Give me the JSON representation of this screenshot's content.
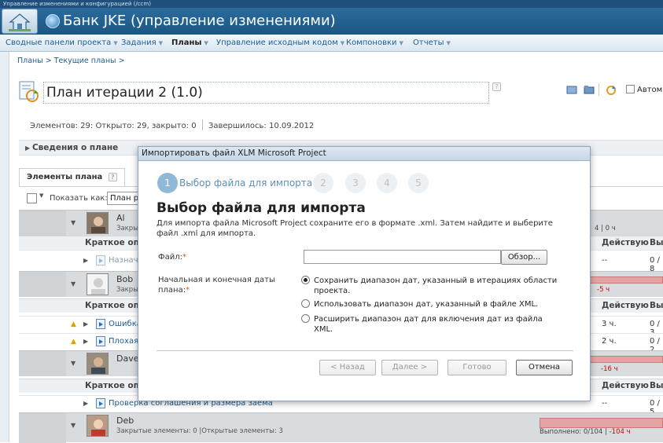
{
  "app": {
    "top_strip": "Управление изменениями и конфигурацией (/ccm)",
    "project_title": "Банк JKE (управление изменениями)"
  },
  "nav": [
    {
      "label": "Сводные панели проекта",
      "active": false
    },
    {
      "label": "Задания",
      "active": false
    },
    {
      "label": "Планы",
      "active": true
    },
    {
      "label": "Управление исходным кодом",
      "active": false
    },
    {
      "label": "Компоновки",
      "active": false
    },
    {
      "label": "Отчеты",
      "active": false
    }
  ],
  "breadcrumb": "Планы > Текущие планы >",
  "plan": {
    "title": "План итерации 2 (1.0)",
    "auto_label": "Автом",
    "stats": {
      "elements": "Элементов: 29:",
      "open_closed": "Открыто: 29, закрыто: 0",
      "finished": "Завершилось:  10.09.2012"
    },
    "info_label": "Сведения о плане",
    "tab_label": "Элементы плана",
    "show_as_label": "Показать как:",
    "show_as_value": "План р"
  },
  "table": {
    "col_summary": "Краткое опи",
    "col_action": "Действую",
    "col_next": "Вы"
  },
  "owners": [
    {
      "name": "Al",
      "sub": "Закры",
      "bar_fill_pct": 0,
      "bar_text": "4 | 0 ч",
      "bar_neg": "",
      "items": [
        {
          "warn": false,
          "title": "Назнач",
          "title_style": "dim",
          "hours": "--",
          "progress": "0 / 8"
        }
      ]
    },
    {
      "name": "Bob",
      "sub": "Закры",
      "bar_fill_pct": 0,
      "bar_text": "",
      "bar_neg": "-5 ч",
      "items": [
        {
          "warn": true,
          "title": "Ошибка",
          "hours": "3 ч.",
          "progress": "0 / 3"
        },
        {
          "warn": true,
          "title": "Плохая",
          "hours": "2 ч.",
          "progress": "0 / 2"
        }
      ]
    },
    {
      "name": "Dave",
      "sub": "",
      "bar_fill_pct": 0,
      "bar_text": "",
      "bar_neg": "-16 ч",
      "items": [
        {
          "warn": false,
          "title": "Проверка соглашения и размера заема",
          "hours": "--",
          "progress": "0 / 5"
        }
      ]
    },
    {
      "name": "Deb",
      "sub": "Закрытые элементы: 0 |Открытые элементы: 3",
      "bar_fill_pct": 0,
      "bar_text": "Выполнено: 0/104 | ",
      "bar_neg": "-104 ч",
      "items": []
    }
  ],
  "dialog": {
    "title": "Импортировать файл XLM Microsoft Project",
    "steps": [
      "1",
      "2",
      "3",
      "4",
      "5"
    ],
    "step_label": "Выбор файла для импорта",
    "heading": "Выбор файла для импорта",
    "description": "Для импорта файла Microsoft Project сохраните его в формате .xml. Затем найдите и выберите файл .xml для импорта.",
    "file_label": "Файл:",
    "browse_label": "Обзор...",
    "dates_label": "Начальная и конечная даты плана:",
    "radio_options": [
      {
        "label": "Сохранить диапазон дат, указанный в итерациях области проекта.",
        "checked": true
      },
      {
        "label": "Использовать диапазон дат, указанный в файле XML.",
        "checked": false
      },
      {
        "label": "Расширить диапазон дат для включения дат из файла XML.",
        "checked": false
      }
    ],
    "buttons": {
      "back": "< Назад",
      "next": "Далее >",
      "finish": "Готово",
      "cancel": "Отмена"
    }
  },
  "colors": {
    "banner": "#1c5784",
    "link": "#1c5c93",
    "bar": "#e5a3a3",
    "negative": "#cc0000"
  }
}
